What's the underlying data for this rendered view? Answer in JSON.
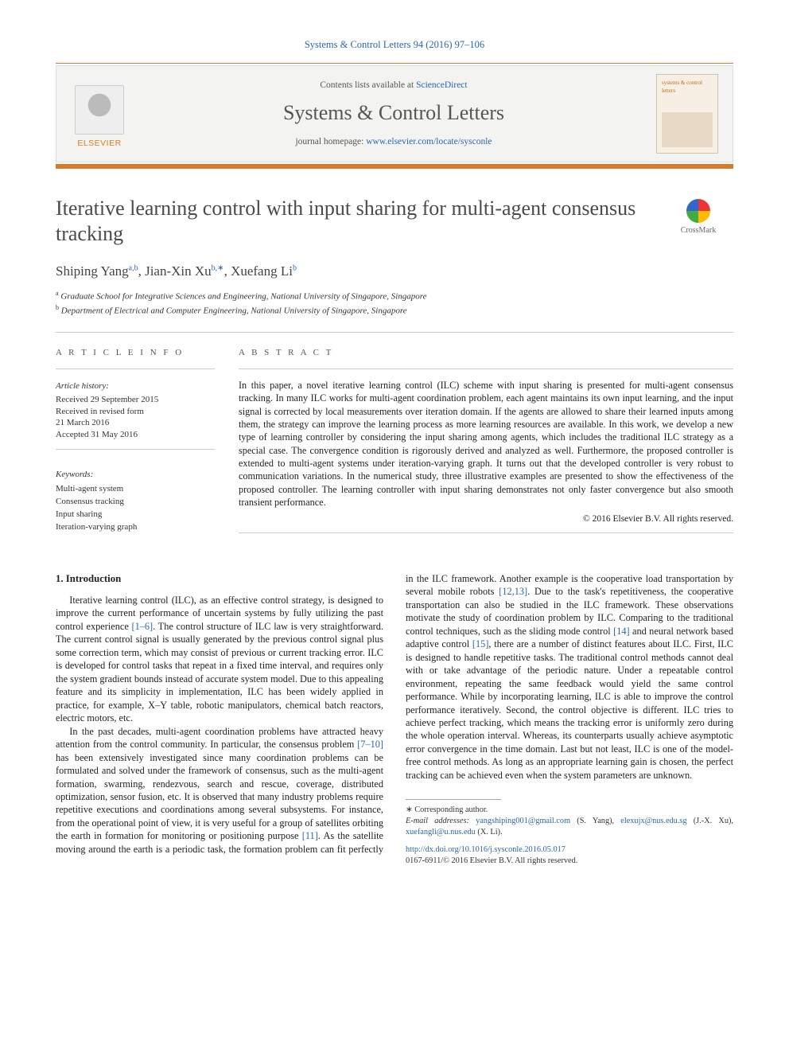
{
  "top_citation": "Systems & Control Letters 94 (2016) 97–106",
  "header": {
    "contents_prefix": "Contents lists available at ",
    "contents_link": "ScienceDirect",
    "journal_title": "Systems & Control Letters",
    "homepage_prefix": "journal homepage: ",
    "homepage_link": "www.elsevier.com/locate/sysconle",
    "publisher": "ELSEVIER",
    "cover_label": "systems & control letters"
  },
  "crossmark": "CrossMark",
  "title": "Iterative learning control with input sharing for multi-agent consensus tracking",
  "authors": {
    "a1_name": "Shiping Yang",
    "a1_aff": "a,b",
    "a2_name": "Jian-Xin Xu",
    "a2_aff": "b,",
    "a2_corr": "∗",
    "a3_name": "Xuefang Li",
    "a3_aff": "b"
  },
  "affiliations": {
    "a_sup": "a",
    "a_text": " Graduate School for Integrative Sciences and Engineering, National University of Singapore, Singapore",
    "b_sup": "b",
    "b_text": " Department of Electrical and Computer Engineering, National University of Singapore, Singapore"
  },
  "info": {
    "heading": "A R T I C L E   I N F O",
    "history_label": "Article history:",
    "received": "Received 29 September 2015",
    "revised1": "Received in revised form",
    "revised2": "21 March 2016",
    "accepted": "Accepted 31 May 2016",
    "kw_label": "Keywords:",
    "kw1": "Multi-agent system",
    "kw2": "Consensus tracking",
    "kw3": "Input sharing",
    "kw4": "Iteration-varying graph"
  },
  "abstract": {
    "heading": "A B S T R A C T",
    "text": "In this paper, a novel iterative learning control (ILC) scheme with input sharing is presented for multi-agent consensus tracking. In many ILC works for multi-agent coordination problem, each agent maintains its own input learning, and the input signal is corrected by local measurements over iteration domain. If the agents are allowed to share their learned inputs among them, the strategy can improve the learning process as more learning resources are available. In this work, we develop a new type of learning controller by considering the input sharing among agents, which includes the traditional ILC strategy as a special case. The convergence condition is rigorously derived and analyzed as well. Furthermore, the proposed controller is extended to multi-agent systems under iteration-varying graph. It turns out that the developed controller is very robust to communication variations. In the numerical study, three illustrative examples are presented to show the effectiveness of the proposed controller. The learning controller with input sharing demonstrates not only faster convergence but also smooth transient performance.",
    "copyright": "© 2016 Elsevier B.V. All rights reserved."
  },
  "section1": {
    "heading": "1. Introduction",
    "p1a": "Iterative learning control (ILC), as an effective control strategy, is designed to improve the current performance of uncertain systems by fully utilizing the past control experience ",
    "p1_ref1": "[1–6]",
    "p1b": ". The control structure of ILC law is very straightforward. The current control signal is usually generated by the previous control signal plus some correction term, which may consist of previous or current tracking error. ILC is developed for control tasks that repeat in a fixed time interval, and requires only the system gradient bounds instead of accurate system model. Due to this appealing feature and its simplicity in implementation, ILC has been widely applied in practice, for example, X–Y table, robotic manipulators, chemical batch reactors, electric motors, etc.",
    "p2a": "In the past decades, multi-agent coordination problems have attracted heavy attention from the control community. In particular, the consensus problem ",
    "p2_ref1": "[7–10]",
    "p2b": " has been extensively investigated since many coordination problems can be formulated and solved under the framework of consensus, such as the multi-agent formation, swarming, rendezvous, search and rescue, coverage, distributed optimization, sensor fusion, etc. It is observed that many industry problems require repetitive executions and coordinations among several subsystems.  For instance, from the operational point of view, it is very useful for a group of satellites orbiting the earth in formation for monitoring or positioning purpose ",
    "p2_ref2": "[11]",
    "p2c": ". As the satellite moving around the earth is a periodic task, the formation problem can fit perfectly in the ILC framework. Another example is the cooperative load transportation by several mobile robots ",
    "p2_ref3": "[12,13]",
    "p2d": ". Due to the task's repetitiveness, the cooperative transportation can also be studied in the ILC framework. These observations motivate the study of coordination problem by ILC. Comparing to the traditional control techniques, such as the sliding mode control ",
    "p2_ref4": "[14]",
    "p2e": " and neural network based adaptive control ",
    "p2_ref5": "[15]",
    "p2f": ", there are a number of distinct features about ILC. First, ILC is designed to handle repetitive tasks. The traditional control methods cannot deal with or take advantage of the periodic nature. Under a repeatable control environment, repeating the same feedback would yield the same control performance. While by incorporating learning, ILC is able to improve the control performance iteratively. Second, the control objective is different. ILC tries to achieve perfect tracking, which means the tracking error is uniformly zero during the whole operation interval. Whereas, its counterparts usually achieve asymptotic error convergence in the time domain. Last but not least, ILC is one of the model-free control methods. As long as an appropriate learning gain is chosen, the perfect tracking can be achieved even when the system parameters are unknown."
  },
  "footnotes": {
    "corr_label": "Corresponding author.",
    "email_label": "E-mail addresses: ",
    "e1": "yangshiping001@gmail.com",
    "e1_who": " (S. Yang), ",
    "e2": "elexujx@nus.edu.sg",
    "e2_who": " (J.-X. Xu), ",
    "e3": "xuefangli@u.nus.edu",
    "e3_who": " (X. Li).",
    "doi": "http://dx.doi.org/10.1016/j.sysconle.2016.05.017",
    "issn": "0167-6911/© 2016 Elsevier B.V. All rights reserved."
  }
}
